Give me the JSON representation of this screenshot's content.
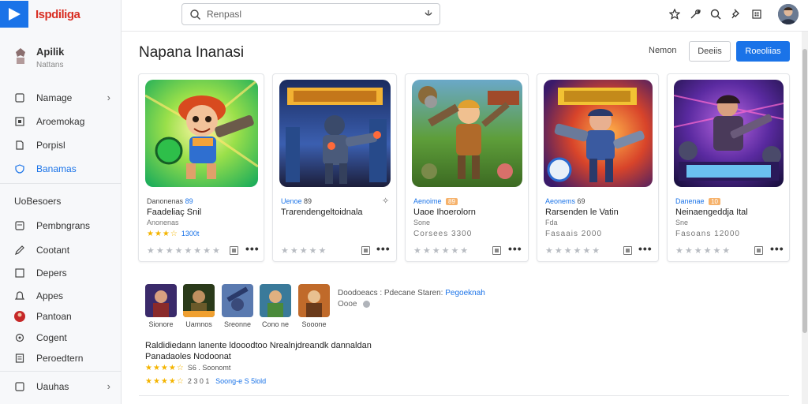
{
  "app": {
    "logo_text": "Ispdiliga"
  },
  "colors": {
    "accent": "#1a73e8",
    "star": "#f4b400",
    "logo": "#d93025"
  },
  "account": {
    "name": "Apilik",
    "sub": "Nattans"
  },
  "sidebar": {
    "items": [
      {
        "label": "Namage",
        "icon": "tablet-icon",
        "chevron": "›"
      },
      {
        "label": "Aroemokag",
        "icon": "square-icon"
      },
      {
        "label": "Porpisl",
        "icon": "page-icon"
      },
      {
        "label": "Banamas",
        "icon": "shield-icon",
        "active": true
      }
    ],
    "section_title": "UoBesoers",
    "items2": [
      {
        "label": "Pembngrans",
        "icon": "tablet-icon"
      },
      {
        "label": "Cootant",
        "icon": "pencil-icon"
      },
      {
        "label": "Depers",
        "icon": "square-icon"
      },
      {
        "label": "Appes",
        "icon": "bell-icon"
      },
      {
        "label": "Pantoan",
        "icon": "red-avatar-icon"
      },
      {
        "label": "Cogent",
        "icon": "gear-icon"
      },
      {
        "label": "Peroedtern",
        "icon": "doc-icon"
      }
    ],
    "footer": {
      "label": "Uauhas",
      "icon": "tablet-icon",
      "chevron": "›"
    }
  },
  "search": {
    "placeholder": "Renpasl"
  },
  "header": {
    "title": "Napana Inanasi",
    "link": "Nemon",
    "outline_button": "Deeiis",
    "primary_button": "Roeoliias"
  },
  "cards": [
    {
      "meta": "Danonenas",
      "badge": "89",
      "title": "Faadeliaç Snil",
      "publisher": "Anonenas",
      "stars": "★★★☆",
      "count": "1300t"
    },
    {
      "meta": "Uenoe",
      "badge": "89",
      "title": "Trarendengeltoidnala",
      "publisher": "",
      "stars": "",
      "count": ""
    },
    {
      "meta": "Aenoime",
      "badge": "89",
      "title": "Uaoe Ihoerolorn",
      "publisher": "Sone",
      "stars": "",
      "count": "",
      "price": "Corsees 3300"
    },
    {
      "meta": "Aeonems",
      "badge": "69",
      "title": "Rarsenden le Vatin",
      "publisher": "Fda",
      "stars": "",
      "count": "",
      "price": "Fasaais 2000"
    },
    {
      "meta": "Danenae",
      "badge": "10",
      "title": "Neinaengeddja Ital",
      "publisher": "Sne",
      "stars": "",
      "count": "",
      "price": "Fasoans 12000"
    }
  ],
  "thumbs": [
    {
      "label": "Sionore"
    },
    {
      "label": "Uamnos"
    },
    {
      "label": "Sreonne"
    },
    {
      "label": "Cono ne"
    },
    {
      "label": "Sooone"
    }
  ],
  "section": {
    "meta": "Doodoeacs : Pdecane Staren:",
    "meta_link": "Pegoeknah",
    "sub": "Oooe",
    "desc1": "Raldidiedann lanente ldooodtoo Nrealnjdreandk dannaldan",
    "desc2": "Panadaoles  Nodoonat",
    "row1_stars": "★★★★☆",
    "row1_text": "S6 . Soonomt",
    "row2_stars": "★★★★☆",
    "row2_text": "2 3 0 1",
    "row2_link": "Soong-e S 5lold"
  },
  "topbar_icons": [
    "star-icon",
    "wrench-icon",
    "search-icon",
    "pin-icon",
    "grid-icon"
  ]
}
